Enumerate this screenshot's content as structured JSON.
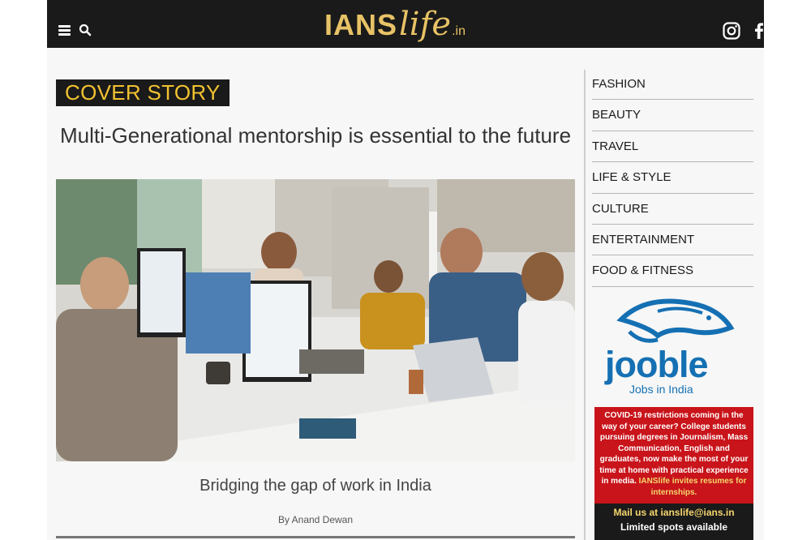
{
  "header": {
    "logo": {
      "part1": "IANS",
      "part2": "life",
      "part3": ".in"
    },
    "icons": [
      "menu-icon",
      "search-icon",
      "instagram-icon",
      "facebook-icon",
      "twitter-icon"
    ]
  },
  "article": {
    "badge": "COVER STORY",
    "title": "Multi-Generational mentorship is essential to the future",
    "caption": "Bridging the gap of work in India",
    "byline": "By Anand Dewan"
  },
  "sidebar": {
    "items": [
      {
        "label": "FASHION"
      },
      {
        "label": "BEAUTY"
      },
      {
        "label": "TRAVEL"
      },
      {
        "label": "LIFE & STYLE"
      },
      {
        "label": "CULTURE"
      },
      {
        "label": "ENTERTAINMENT"
      },
      {
        "label": "FOOD & FITNESS"
      }
    ]
  },
  "ads": {
    "jooble": {
      "brand": "jooble",
      "tagline": "Jobs in India"
    },
    "internship": {
      "body": "COVID-19 restrictions coming in the way of your career? College students pursuing degrees in Journalism, Mass Communication, English and graduates, now make the most of your time at home with practical experience in media.",
      "highlight": "IANSlife invites resumes for internships.",
      "mail": "Mail us at ianslife@ians.in",
      "limited": "Limited spots available"
    }
  },
  "colors": {
    "header_bg": "#1a1a1a",
    "logo_gold": "#e8c266",
    "badge_text": "#f2c230",
    "ad_red": "#c8141a",
    "jooble_blue": "#1570b3"
  }
}
